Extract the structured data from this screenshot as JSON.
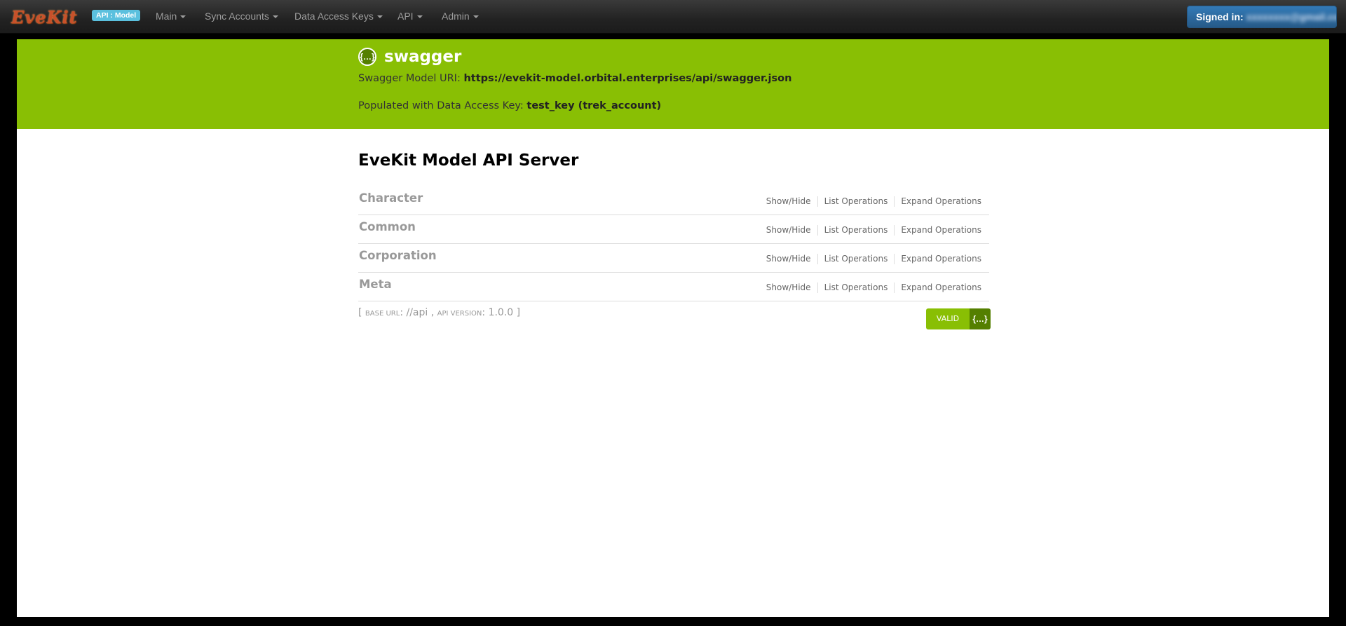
{
  "navbar": {
    "brand": "EveKit",
    "badge": "API : Model",
    "menus": [
      "Main",
      "Sync Accounts",
      "Data Access Keys",
      "API",
      "Admin"
    ],
    "signed_in_label": "Signed in:",
    "signed_in_email": "xxxxxxxx@gmail.com"
  },
  "header": {
    "logo_icon": "{…}",
    "logo_text": "swagger",
    "uri_label": "Swagger Model URI:",
    "uri_value": "https://evekit-model.orbital.enterprises/api/swagger.json",
    "key_label": "Populated with Data Access Key:",
    "key_value": "test_key (trek_account)"
  },
  "main": {
    "title": "EveKit Model API Server",
    "resources": [
      {
        "name": "Character"
      },
      {
        "name": "Common"
      },
      {
        "name": "Corporation"
      },
      {
        "name": "Meta"
      }
    ],
    "ops": {
      "show_hide": "Show/Hide",
      "list": "List Operations",
      "expand": "Expand Operations"
    },
    "footer": {
      "open": "[",
      "base_url_label": "base url",
      "base_url_value": "//api",
      "comma": ",",
      "api_version_label": "api version",
      "api_version_value": "1.0.0",
      "close": "]"
    },
    "validator": {
      "label": "VALID",
      "icon": "{…}"
    }
  },
  "colors": {
    "swagger_green": "#89bf04",
    "swagger_dark_green": "#547f00",
    "navbar_bg": "#222222",
    "signin_blue": "#337ab7",
    "badge_blue": "#5bc0de"
  }
}
